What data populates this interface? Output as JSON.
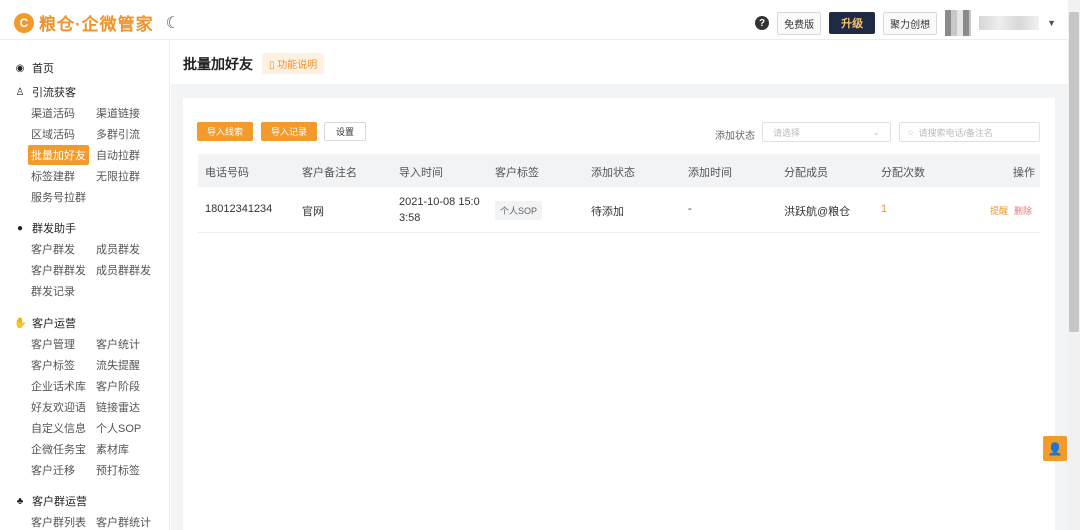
{
  "header": {
    "logo_mark": "C",
    "app_name": "粮仓·企微管家",
    "free_tag": "免费版",
    "upgrade_label": "升级",
    "company_tag": "聚力创想"
  },
  "sidebar": {
    "home_label": "首页",
    "sections": [
      {
        "title": "引流获客",
        "icon": "user-icon",
        "items": [
          "渠道活码",
          "渠道链接",
          "区域活码",
          "多群引流",
          "批量加好友",
          "自动拉群",
          "标签建群",
          "无限拉群",
          "服务号拉群"
        ]
      },
      {
        "title": "群发助手",
        "icon": "chat-icon",
        "items": [
          "客户群发",
          "成员群发",
          "客户群群发",
          "成员群群发",
          "群发记录"
        ]
      },
      {
        "title": "客户运营",
        "icon": "handshake-icon",
        "items": [
          "客户管理",
          "客户统计",
          "客户标签",
          "流失提醒",
          "企业话术库",
          "客户阶段",
          "好友欢迎语",
          "链接雷达",
          "自定义信息",
          "个人SOP",
          "企微任务宝",
          "素材库",
          "客户迁移",
          "预打标签"
        ]
      },
      {
        "title": "客户群运营",
        "icon": "org-chart-icon",
        "items": [
          "客户群列表",
          "客户群统计"
        ]
      }
    ],
    "active_item": "批量加好友"
  },
  "page": {
    "title": "批量加好友",
    "func_link": "功能说明"
  },
  "toolbar": {
    "import_leads": "导入线索",
    "import_records": "导入记录",
    "settings": "设置",
    "filter_label": "添加状态",
    "select_placeholder": "请选择",
    "search_placeholder": "请搜索电话/备注名"
  },
  "table": {
    "columns": [
      "电话号码",
      "客户备注名",
      "导入时间",
      "客户标签",
      "添加状态",
      "添加时间",
      "分配成员",
      "分配次数",
      "操作"
    ],
    "rows": [
      {
        "phone": "18012341234",
        "remark": "官网",
        "import_time_line1": "2021-10-08 15:0",
        "import_time_line2": "3:58",
        "tag": "个人SOP",
        "status": "待添加",
        "add_time": "-",
        "member": "洪跃航@粮仓",
        "count": "1",
        "action_remind": "提醒",
        "action_delete": "删除"
      }
    ]
  },
  "colors": {
    "brand_orange": "#f29b2a",
    "upgrade_bg": "#1f2a44"
  }
}
